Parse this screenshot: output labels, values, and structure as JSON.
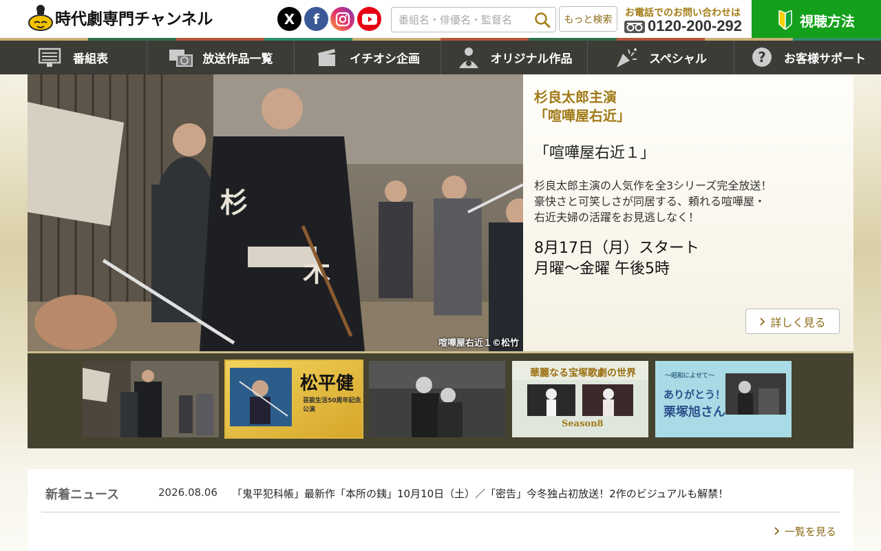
{
  "header": {
    "logo_text": "時代劇専門チャンネル",
    "social": {
      "x": "X",
      "facebook": "f",
      "instagram": "Instagram",
      "youtube": "YouTube"
    },
    "search_placeholder": "番組名・俳優名・監督名",
    "more_search": "もっと検索",
    "phone_label": "お電話でのお問い合わせは",
    "phone_number": "0120-200-292",
    "how_to_watch": "視聴方法"
  },
  "stripe_colors": [
    "#c7b072",
    "#2e6e4a",
    "#b5553a",
    "#2c8e6a",
    "#c7b072",
    "#b5553a",
    "#2e6e4a",
    "#b5553a",
    "#c7b072",
    "#2c8e6a"
  ],
  "nav": [
    {
      "label": "番組表",
      "icon": "tv-schedule-icon"
    },
    {
      "label": "放送作品一覧",
      "icon": "screens-icon"
    },
    {
      "label": "イチオシ企画",
      "icon": "clapperboard-icon"
    },
    {
      "label": "オリジナル作品",
      "icon": "samurai-icon"
    },
    {
      "label": "スペシャル",
      "icon": "party-popper-icon"
    },
    {
      "label": "お客様サポート",
      "icon": "question-icon"
    }
  ],
  "hero": {
    "caption": "喧嘩屋右近１©松竹",
    "subtitle_line1": "杉良太郎主演",
    "subtitle_line2": "「喧嘩屋右近」",
    "title": "「喧嘩屋右近１」",
    "desc_line1": "杉良太郎主演の人気作を全3シリーズ完全放送！",
    "desc_line2": "豪快さと可笑しさが同居する、頼れる喧嘩屋・",
    "desc_line3": "右近夫婦の活躍をお見逃しなく！",
    "date_line1": "8月17日（月）スタート",
    "date_line2": "月曜～金曜 午後5時",
    "more": "詳しく見る"
  },
  "thumbnails": {
    "t2_title": "松平健",
    "t2_sub": "芸能生活50周年記念公演",
    "t4_title": "華麗なる宝塚歌劇の世界",
    "t4_season": "Season8",
    "t5_top": "～昭和によせて～",
    "t5_line1": "ありがとう！",
    "t5_line2": "栗塚旭さん"
  },
  "news": {
    "label": "新着ニュース",
    "date": "2026.08.06",
    "text": "「鬼平犯科帳」最新作「本所の銕」10月10日（土）／「密告」今冬独占初放送！2作のビジュアルも解禁！",
    "more": "一覧を見る"
  }
}
